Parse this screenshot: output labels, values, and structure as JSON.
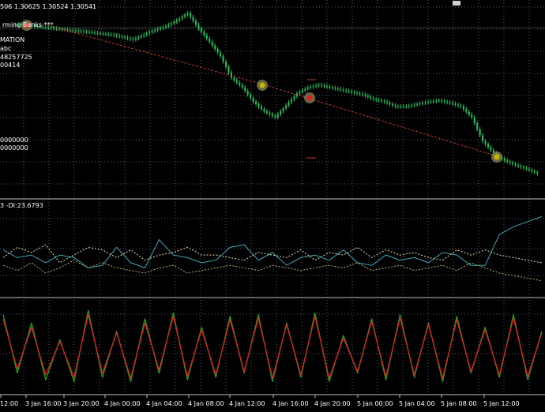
{
  "header": {
    "ohlc_text": "506 1.30625 1.30524 1.30541",
    "close_icon": "close-icon"
  },
  "info_panel": {
    "line1": "rming Banks",
    "line1_suffix": "***",
    "line2": "MATION",
    "line3": "abc",
    "line4": "48257725",
    "line5": "00414",
    "line6": "0000000",
    "line7": "0000000"
  },
  "indicator_panel": {
    "label": "3 -DI:23.6793"
  },
  "time_axis": {
    "labels": [
      "12:00",
      "3 Jan 16:00",
      "3 Jan 20:00",
      "4 Jan 00:00",
      "4 Jan 04:00",
      "4 Jan 08:00",
      "4 Jan 12:00",
      "4 Jan 16:00",
      "4 Jan 20:00",
      "5 Jan 00:00",
      "5 Jan 04:00",
      "5 Jan 08:00",
      "5 Jan 12:00"
    ]
  },
  "colors": {
    "background": "#000000",
    "grid": "#6b7280",
    "bull_candle": "#22c55e",
    "trend_line": "#c0392b",
    "adx_main": "#3fa7b8",
    "di_plus": "#e6e6b0",
    "di_minus": "#b8b870",
    "stoch_main": "#1f9e1f",
    "stoch_signal": "#e0201c",
    "marker": "#c8b400"
  },
  "chart_data": [
    {
      "type": "line",
      "panel": "price",
      "series": [
        {
          "values": [
            1.3062,
            1.3063,
            1.3061,
            1.306,
            1.3059,
            1.3058,
            1.3057,
            1.3056,
            1.3055,
            1.3054,
            1.3052,
            1.305,
            1.3054,
            1.3058,
            1.3061,
            1.3066,
            1.3072,
            1.3059,
            1.3048,
            1.3036,
            1.3018,
            1.301,
            1.2998,
            1.299,
            1.2985,
            1.2995,
            1.3005,
            1.301,
            1.3012,
            1.301,
            1.3008,
            1.3006,
            1.3004,
            1.3,
            1.2998,
            1.2994,
            1.2994,
            1.2996,
            1.2998,
            1.2999,
            1.2997,
            1.2994,
            1.2985,
            1.2965,
            1.2955,
            1.2949,
            1.2945,
            1.2942,
            1.2938
          ]
        }
      ],
      "markers": [
        "signal-1",
        "signal-2",
        "signal-3",
        "signal-4"
      ]
    },
    {
      "type": "line",
      "panel": "adx",
      "series": [
        {
          "values": [
            34,
            28,
            30,
            24,
            30,
            28,
            20,
            22,
            36,
            24,
            20,
            42,
            30,
            28,
            24,
            26,
            36,
            38,
            26,
            32,
            22,
            28,
            30,
            26,
            34,
            24,
            22,
            30,
            26,
            28,
            24,
            32,
            30,
            22,
            22,
            46,
            52,
            56,
            60
          ]
        },
        {
          "values": [
            28,
            36,
            32,
            38,
            24,
            30,
            36,
            34,
            28,
            34,
            26,
            30,
            32,
            36,
            30,
            30,
            28,
            26,
            32,
            30,
            28,
            34,
            26,
            32,
            30,
            36,
            28,
            34,
            30,
            32,
            28,
            26,
            34,
            30,
            34,
            30,
            28,
            26,
            24
          ]
        },
        {
          "values": [
            22,
            18,
            24,
            16,
            20,
            26,
            20,
            24,
            20,
            18,
            16,
            20,
            22,
            16,
            18,
            20,
            22,
            20,
            18,
            22,
            20,
            18,
            20,
            22,
            20,
            24,
            18,
            20,
            22,
            18,
            20,
            22,
            18,
            24,
            20,
            16,
            14,
            12,
            10
          ]
        }
      ]
    },
    {
      "type": "line",
      "panel": "stochastic",
      "series": [
        {
          "values": [
            90,
            20,
            80,
            12,
            60,
            10,
            95,
            15,
            70,
            10,
            85,
            20,
            92,
            12,
            75,
            15,
            88,
            20,
            90,
            10,
            80,
            15,
            92,
            10,
            65,
            20,
            85,
            12,
            90,
            15,
            80,
            10,
            88,
            20,
            75,
            15,
            90,
            12,
            70
          ]
        },
        {
          "values": [
            85,
            25,
            75,
            18,
            58,
            15,
            90,
            20,
            68,
            14,
            80,
            24,
            88,
            16,
            72,
            18,
            84,
            22,
            86,
            14,
            78,
            18,
            88,
            14,
            62,
            22,
            82,
            16,
            86,
            18,
            78,
            14,
            84,
            22,
            72,
            18,
            86,
            16,
            68
          ]
        }
      ]
    }
  ]
}
